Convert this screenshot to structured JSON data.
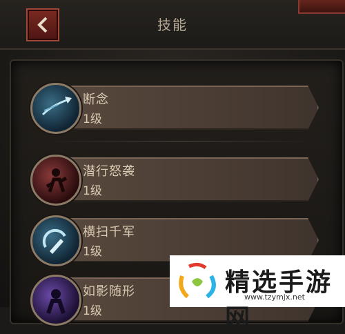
{
  "header": {
    "title": "技能",
    "back_label": "<"
  },
  "skills": [
    {
      "name": "断念",
      "level": "1级",
      "icon": "thrown-blade-icon"
    },
    {
      "name": "潜行怒袭",
      "level": "1级",
      "icon": "stealth-assassin-icon"
    },
    {
      "name": "横扫千军",
      "level": "1级",
      "icon": "sweeping-blade-icon"
    },
    {
      "name": "如影随形",
      "level": "1级",
      "icon": "shadow-figure-icon"
    }
  ],
  "watermark": {
    "text": "精选手游网",
    "url": "www.tzymjx.net"
  },
  "colors": {
    "accent": "#7a2a22",
    "bar": "#5a4a3f",
    "text": "#d8cbb2"
  }
}
